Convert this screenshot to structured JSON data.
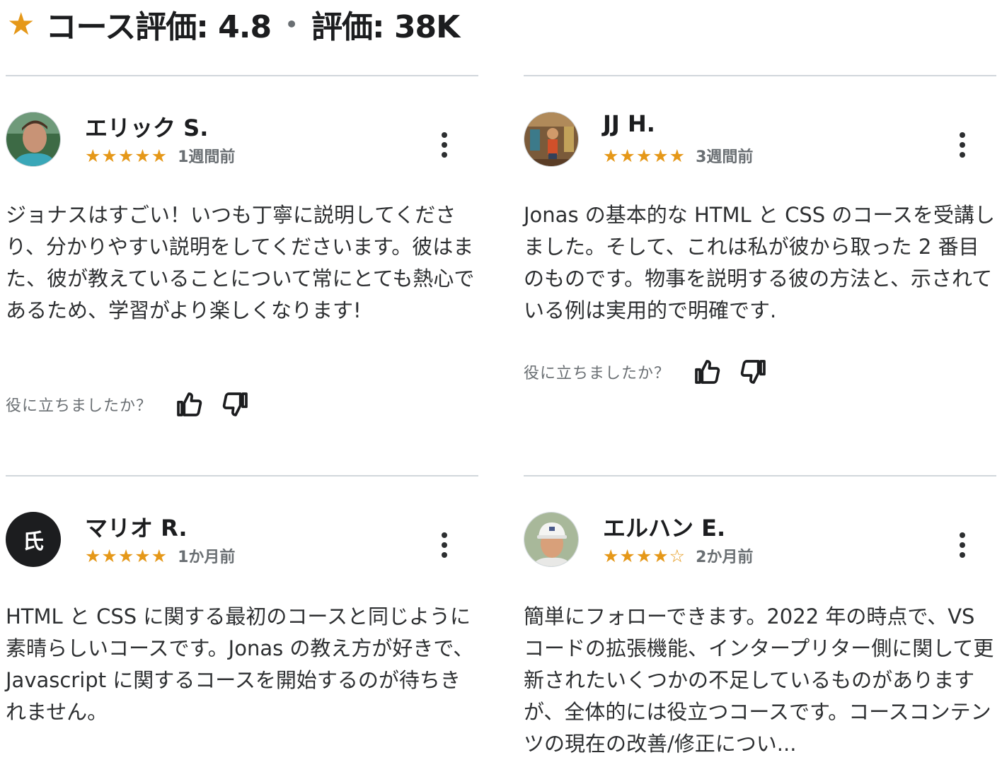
{
  "header": {
    "star_icon": "star-icon",
    "rating_label": "コース評価: 4.8",
    "separator": "•",
    "count_label": "評価: 38K"
  },
  "helpful_question": "役に立ちましたか？",
  "colors": {
    "star": "#e59819",
    "text": "#2d2f31",
    "muted": "#6a6f73",
    "divider": "#d1d7dc"
  },
  "reviews": [
    {
      "name": "エリック S.",
      "avatar": "photo",
      "stars": "★★★★★",
      "rating": 5,
      "when": "1週間前",
      "body": "ジョナスはすごい！いつも丁寧に説明してくださり、分かりやすい説明をしてくださいます。彼はまた、彼が教えていることについて常にとても熱心であるため、学習がより楽しくなります!"
    },
    {
      "name": "JJ H.",
      "avatar": "photo",
      "stars": "★★★★★",
      "rating": 5,
      "when": "3週間前",
      "body": "Jonas の基本的な HTML と CSS のコースを受講しました。そして、これは私が彼から取った 2 番目のものです。物事を説明する彼の方法と、示されている例は実用的で明確です."
    },
    {
      "name": "マリオ R.",
      "avatar": "initials",
      "initials": "氏",
      "stars": "★★★★★",
      "rating": 5,
      "when": "1か月前",
      "body": "HTML と CSS に関する最初のコースと同じように素晴らしいコースです。Jonas の教え方が好きで、Javascript に関するコースを開始するのが待ちきれません。"
    },
    {
      "name": "エルハン E.",
      "avatar": "photo",
      "stars": "★★★★☆",
      "rating": 4,
      "when": "2か月前",
      "body": "簡単にフォローできます。2022 年の時点で、VS コードの拡張機能、インタープリター側に関して更新されたいくつかの不足しているものがありますが、全体的には役立つコースです。コースコンテンツの現在の改善/修正につい..."
    }
  ]
}
